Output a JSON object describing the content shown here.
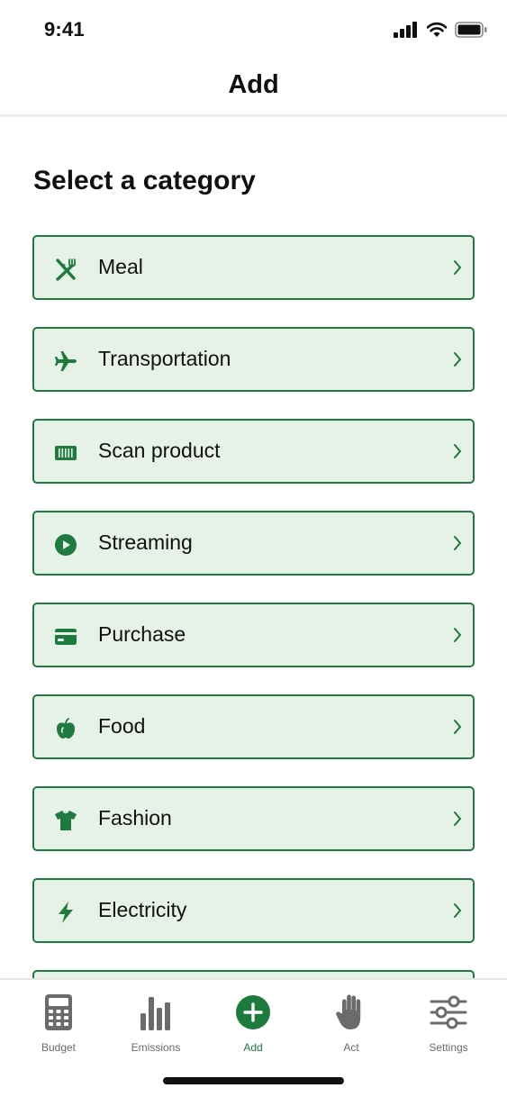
{
  "status_bar": {
    "time": "9:41",
    "icons": [
      "signal-icon",
      "wifi-icon",
      "battery-icon"
    ]
  },
  "header": {
    "title": "Add"
  },
  "section_title": "Select a category",
  "accent_color": "#1e7a3d",
  "item_background": "#e6f1e8",
  "categories": [
    {
      "label": "Meal",
      "icon": "fork-knife-icon"
    },
    {
      "label": "Transportation",
      "icon": "airplane-icon"
    },
    {
      "label": "Scan product",
      "icon": "barcode-icon"
    },
    {
      "label": "Streaming",
      "icon": "play-circle-icon"
    },
    {
      "label": "Purchase",
      "icon": "credit-card-icon"
    },
    {
      "label": "Food",
      "icon": "apple-icon"
    },
    {
      "label": "Fashion",
      "icon": "tshirt-icon"
    },
    {
      "label": "Electricity",
      "icon": "lightning-icon"
    },
    {
      "label": "",
      "icon": ""
    }
  ],
  "tabs": [
    {
      "label": "Budget",
      "icon": "calculator-icon",
      "active": false
    },
    {
      "label": "Emissions",
      "icon": "bar-chart-icon",
      "active": false
    },
    {
      "label": "Add",
      "icon": "plus-circle-icon",
      "active": true
    },
    {
      "label": "Act",
      "icon": "hand-icon",
      "active": false
    },
    {
      "label": "Settings",
      "icon": "sliders-icon",
      "active": false
    }
  ]
}
